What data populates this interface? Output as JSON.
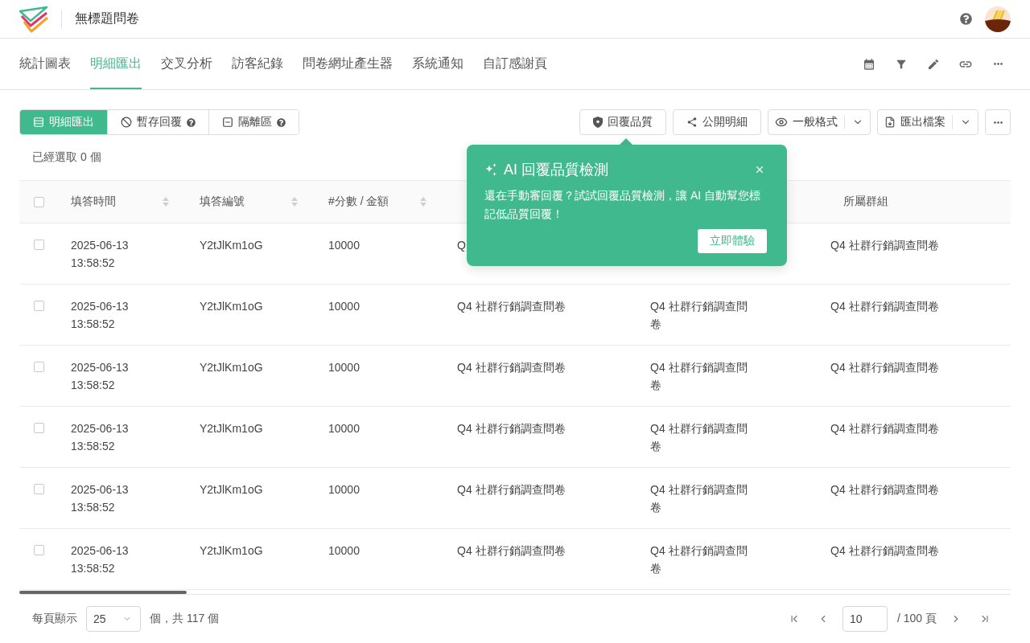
{
  "header": {
    "title": "無標題問卷"
  },
  "nav_tabs": [
    {
      "label": "統計圖表",
      "selected": false
    },
    {
      "label": "明細匯出",
      "selected": true
    },
    {
      "label": "交叉分析",
      "selected": false
    },
    {
      "label": "訪客紀錄",
      "selected": false
    },
    {
      "label": "問卷網址產生器",
      "selected": false
    },
    {
      "label": "系統通知",
      "selected": false
    },
    {
      "label": "自訂感謝頁",
      "selected": false
    }
  ],
  "segments": [
    {
      "label": "明細匯出",
      "kind": "list",
      "selected": true,
      "help": false
    },
    {
      "label": "暫存回覆",
      "kind": "ban",
      "selected": false,
      "help": true
    },
    {
      "label": "隔離區",
      "kind": "minus",
      "selected": false,
      "help": true
    }
  ],
  "actions": [
    {
      "label": "回覆品質",
      "kind": "shield",
      "dropdown": false
    },
    {
      "label": "公開明細",
      "kind": "share",
      "dropdown": false
    },
    {
      "label": "一般格式",
      "kind": "eye",
      "dropdown": true
    },
    {
      "label": "匯出檔案",
      "kind": "export",
      "dropdown": true
    }
  ],
  "selection_count": "已經選取 0 個",
  "table": {
    "all_checked": false,
    "columns": [
      {
        "label": "填答時間",
        "sortable": true
      },
      {
        "label": "填答編號",
        "sortable": true
      },
      {
        "label": "#分數 / 金額",
        "sortable": true
      },
      null,
      null,
      {
        "label": "所屬群組",
        "sortable": false
      }
    ],
    "rows": [
      {
        "checked": false,
        "cells": [
          "2025-06-13 13:58:52",
          "Y2tJlKm1oG",
          "10000",
          "Q",
          null,
          "Q4 社群行銷調查問卷"
        ]
      },
      {
        "checked": false,
        "cells": [
          "2025-06-13 13:58:52",
          "Y2tJlKm1oG",
          "10000",
          "Q4 社群行銷調查問卷",
          "Q4 社群行銷調查問卷",
          "Q4 社群行銷調查問卷"
        ]
      },
      {
        "checked": false,
        "cells": [
          "2025-06-13 13:58:52",
          "Y2tJlKm1oG",
          "10000",
          "Q4 社群行銷調查問卷",
          "Q4 社群行銷調查問卷",
          "Q4 社群行銷調查問卷"
        ]
      },
      {
        "checked": false,
        "cells": [
          "2025-06-13 13:58:52",
          "Y2tJlKm1oG",
          "10000",
          "Q4 社群行銷調查問卷",
          "Q4 社群行銷調查問卷",
          "Q4 社群行銷調查問卷"
        ]
      },
      {
        "checked": false,
        "cells": [
          "2025-06-13 13:58:52",
          "Y2tJlKm1oG",
          "10000",
          "Q4 社群行銷調查問卷",
          "Q4 社群行銷調查問卷",
          "Q4 社群行銷調查問卷"
        ]
      },
      {
        "checked": false,
        "cells": [
          "2025-06-13 13:58:52",
          "Y2tJlKm1oG",
          "10000",
          "Q4 社群行銷調查問卷",
          "Q4 社群行銷調查問卷",
          "Q4 社群行銷調查問卷"
        ]
      }
    ]
  },
  "popover": {
    "title": "AI 回覆品質檢測",
    "body": "還在手動審回覆？試試回覆品質檢測，讓 AI 自動幫您標記低品質回覆！",
    "button": "立即體驗"
  },
  "pagination": {
    "per_page_label": "每頁顯示",
    "per_page": "25",
    "total": "個，共 117 個",
    "page": "10",
    "page_count": "/ 100 頁"
  }
}
